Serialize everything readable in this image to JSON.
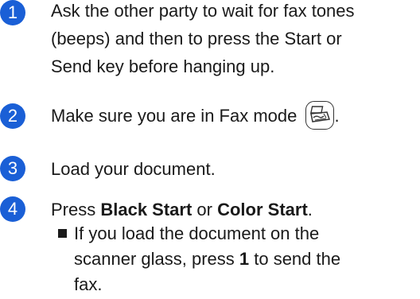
{
  "steps": [
    {
      "number": "1",
      "lines": [
        "Ask the other party to wait for fax tones",
        "(beeps) and then to press the Start or",
        "Send key before hanging up."
      ]
    },
    {
      "number": "2",
      "text_before": "Make sure you are in Fax mode",
      "icon": "fax-mode-key-icon",
      "text_after": "."
    },
    {
      "number": "3",
      "text": "Load your document."
    },
    {
      "number": "4",
      "prefix": "Press ",
      "bold1": "Black Start",
      "middle": " or ",
      "bold2": "Color Start",
      "suffix": ".",
      "sub": {
        "line1": "If you load the document on the",
        "line2_pre": "scanner glass, press ",
        "line2_bold": "1",
        "line2_post": " to send the",
        "line3": "fax."
      }
    }
  ],
  "colors": {
    "step_badge": "#1a5fd6",
    "text": "#1a1a1a"
  }
}
